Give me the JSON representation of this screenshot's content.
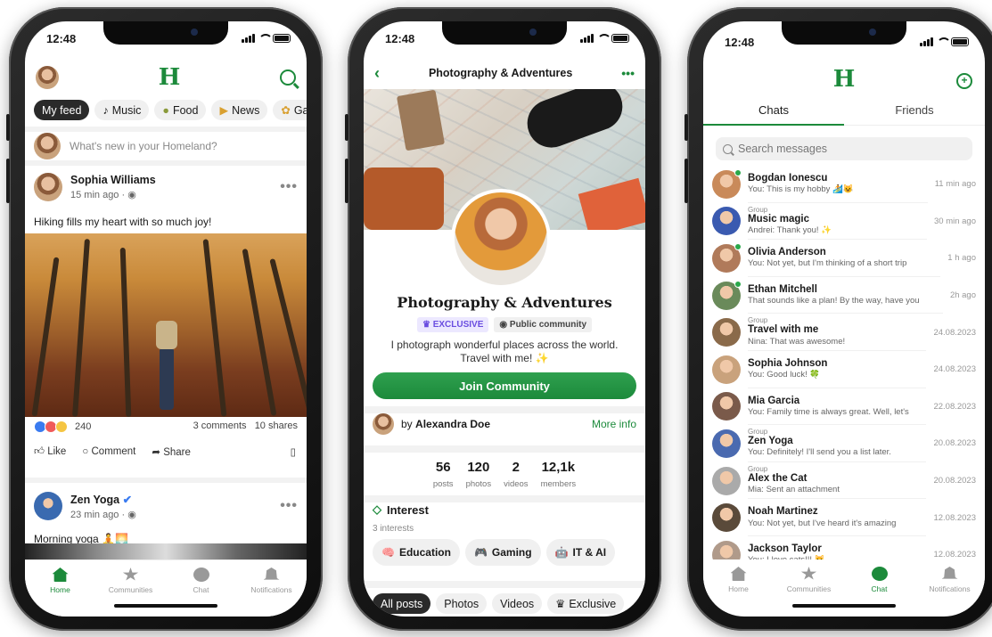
{
  "status": {
    "time": "12:48"
  },
  "feed": {
    "chips": [
      {
        "label": "My feed",
        "icon": ""
      },
      {
        "label": "Music",
        "icon": "♪"
      },
      {
        "label": "Food",
        "icon": "●"
      },
      {
        "label": "News",
        "icon": "▶"
      },
      {
        "label": "Gar",
        "icon": "✿"
      }
    ],
    "compose_placeholder": "What's new in your Homeland?",
    "post1": {
      "author": "Sophia Williams",
      "time": "15 min ago ·",
      "text": "Hiking fills my heart with so much joy!",
      "reactions": "240",
      "comments": "3 comments",
      "shares": "10 shares"
    },
    "actions": {
      "like": "Like",
      "comment": "Comment",
      "share": "Share"
    },
    "post2": {
      "author": "Zen Yoga",
      "time": "23 min ago ·",
      "text": "Morning yoga 🧘🌅"
    }
  },
  "tabs": {
    "home": "Home",
    "communities": "Communities",
    "chat": "Chat",
    "notifications": "Notifications"
  },
  "community": {
    "header_title": "Photography & Adventures",
    "name": "Photography & Adventures",
    "badge_exclusive": "EXCLUSIVE",
    "badge_public": "Public community",
    "description": "I photograph wonderful places across the world. Travel with me! ✨",
    "join_label": "Join Community",
    "owner_prefix": "by",
    "owner_name": "Alexandra Doe",
    "more_info": "More info",
    "stats": [
      {
        "value": "56",
        "label": "posts"
      },
      {
        "value": "120",
        "label": "photos"
      },
      {
        "value": "2",
        "label": "videos"
      },
      {
        "value": "12,1k",
        "label": "members"
      }
    ],
    "interest_title": "Interest",
    "interest_count": "3 interests",
    "interests": [
      {
        "icon": "🧠",
        "label": "Education"
      },
      {
        "icon": "🎮",
        "label": "Gaming"
      },
      {
        "icon": "🤖",
        "label": "IT & AI"
      }
    ],
    "post_tabs": [
      "All posts",
      "Photos",
      "Videos",
      "Exclusive"
    ]
  },
  "chats": {
    "tab_chats": "Chats",
    "tab_friends": "Friends",
    "search_placeholder": "Search messages",
    "items": [
      {
        "group": "",
        "name": "Bogdan Ionescu",
        "preview": "You: This is my hobby 🏄😺",
        "time": "11 min ago",
        "online": true
      },
      {
        "group": "Group",
        "name": "Music magic",
        "preview": "Andrei: Thank you! ✨",
        "time": "30 min ago",
        "online": false
      },
      {
        "group": "",
        "name": "Olivia Anderson",
        "preview": "You: Not yet, but I'm thinking of a short trip",
        "time": "1 h ago",
        "online": true
      },
      {
        "group": "",
        "name": "Ethan Mitchell",
        "preview": "That sounds like a plan! By the way, have you",
        "time": "2h ago",
        "online": true
      },
      {
        "group": "Group",
        "name": "Travel with me",
        "preview": "Nina: That was awesome!",
        "time": "24.08.2023",
        "online": false
      },
      {
        "group": "",
        "name": "Sophia Johnson",
        "preview": "You: Good luck! 🍀",
        "time": "24.08.2023",
        "online": false
      },
      {
        "group": "",
        "name": "Mia Garcia",
        "preview": "You: Family time is always great. Well, let's",
        "time": "22.08.2023",
        "online": false
      },
      {
        "group": "Group",
        "name": "Zen Yoga",
        "preview": "You: Definitely! I'll send you a list later.",
        "time": "20.08.2023",
        "online": false
      },
      {
        "group": "Group",
        "name": "Alex the Cat",
        "preview": "Mia: Sent an attachment",
        "time": "20.08.2023",
        "online": false
      },
      {
        "group": "",
        "name": "Noah Martinez",
        "preview": "You: Not yet, but I've heard it's amazing",
        "time": "12.08.2023",
        "online": false
      },
      {
        "group": "",
        "name": "Jackson Taylor",
        "preview": "You: I love cats!!! 😺",
        "time": "12.08.2023",
        "online": false
      }
    ]
  },
  "colors": {
    "brand": "#1c8a3b",
    "exclusive": "#6a4de0",
    "online": "#2aa84a"
  }
}
